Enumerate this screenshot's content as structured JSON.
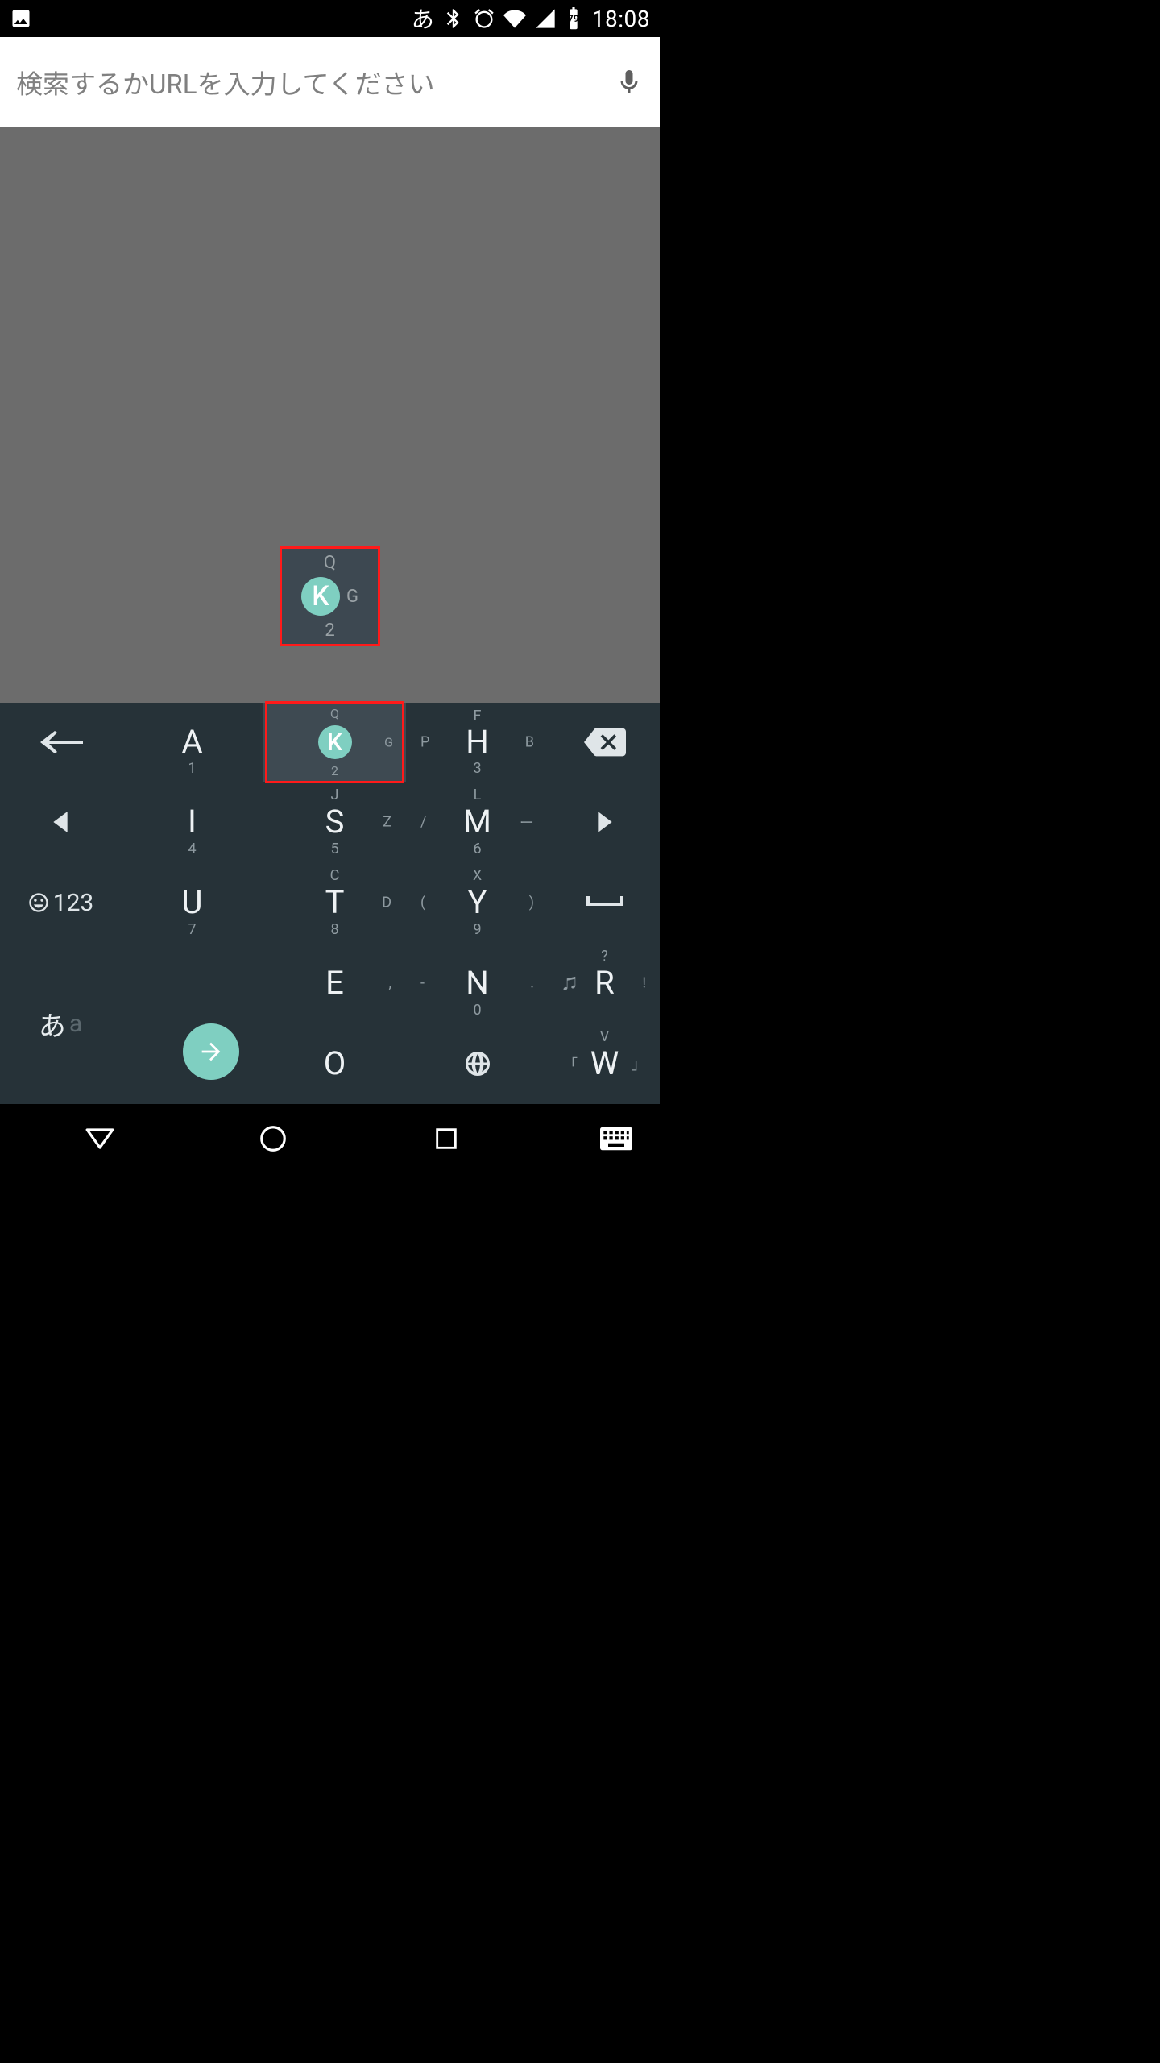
{
  "statusbar": {
    "ime_indicator": "あ",
    "battery_level": "79",
    "clock": "18:08"
  },
  "searchbar": {
    "placeholder": "検索するかURLを入力してください"
  },
  "popup": {
    "top": "Q",
    "center": "K",
    "right": "G",
    "bottom": "2"
  },
  "keys": {
    "r1c2": {
      "main": "A",
      "num": "1"
    },
    "r1c3_pressed": {
      "top": "Q",
      "main": "K",
      "right": "G",
      "num": "2"
    },
    "r1c4": {
      "top": "F",
      "left": "P",
      "main": "H",
      "right": "B",
      "num": "3"
    },
    "r2c2": {
      "main": "I",
      "num": "4"
    },
    "r2c3": {
      "top": "J",
      "main": "S",
      "right": "Z",
      "num": "5"
    },
    "r2c4": {
      "top": "L",
      "left": "/",
      "main": "M",
      "right": "ー",
      "num": "6"
    },
    "r3c2": {
      "main": "U",
      "num": "7"
    },
    "r3c3": {
      "top": "C",
      "main": "T",
      "right": "D",
      "num": "8"
    },
    "r3c4": {
      "top": "X",
      "left": "(",
      "main": "Y",
      "right": ")",
      "num": "9"
    },
    "r4c2": {
      "main": "E",
      "right": ","
    },
    "r4c3": {
      "left": "-",
      "main": "N",
      "right": ".",
      "num": "0"
    },
    "r4c4": {
      "top": "?",
      "left": "♫",
      "main": "R",
      "right": "!"
    },
    "r5c2": {
      "main": "O"
    },
    "r5c4": {
      "top": "V",
      "left": "「",
      "main": "W",
      "right": "」"
    }
  },
  "lang": {
    "jp": "あ",
    "en": "a"
  },
  "emoji123": {
    "text": "123"
  }
}
